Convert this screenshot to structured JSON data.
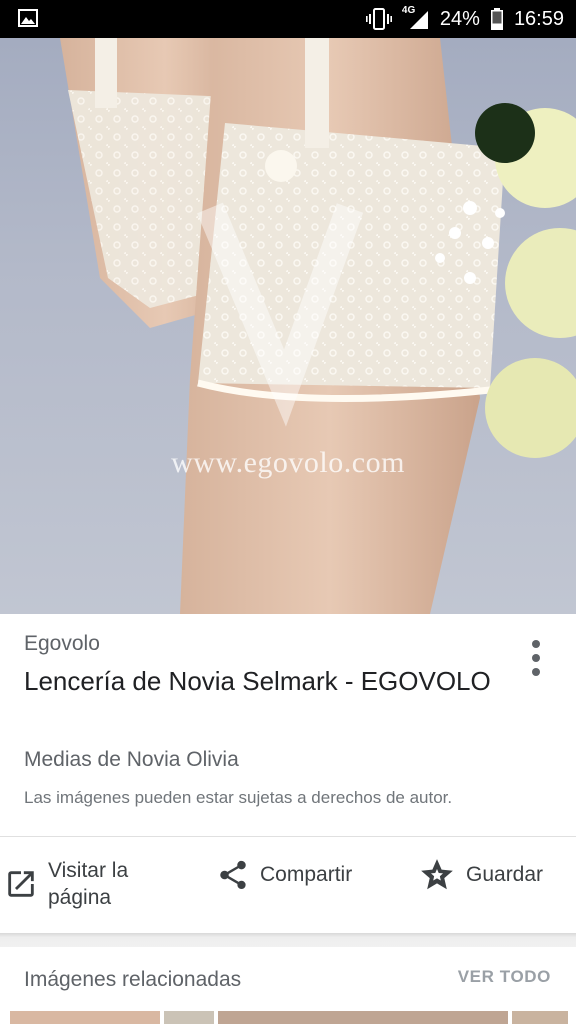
{
  "status_bar": {
    "network": "4G",
    "battery": "24%",
    "time": "16:59"
  },
  "hero": {
    "watermark": "www.egovolo.com"
  },
  "result": {
    "source": "Egovolo",
    "title": "Lencería de Novia Selmark - EGOVOLO",
    "subtitle": "Medias de Novia Olivia",
    "copyright_notice": "Las imágenes pueden estar sujetas a derechos de autor."
  },
  "actions": {
    "visit_line1": "Visitar la",
    "visit_line2": "página",
    "share": "Compartir",
    "save": "Guardar"
  },
  "related": {
    "title": "Imágenes relacionadas",
    "see_all": "VER TODO"
  },
  "icons": {
    "status_gallery": "image-icon",
    "vibrate": "vibrate-icon",
    "signal": "signal-icon",
    "battery": "battery-icon",
    "more": "more-vert-icon",
    "visit": "open-in-new-icon",
    "share": "share-icon",
    "save": "star-icon"
  },
  "colors": {
    "status_bar_bg": "#000000",
    "primary_text": "#202124",
    "secondary_text": "#5f6368",
    "see_all": "#9aa0a6"
  }
}
